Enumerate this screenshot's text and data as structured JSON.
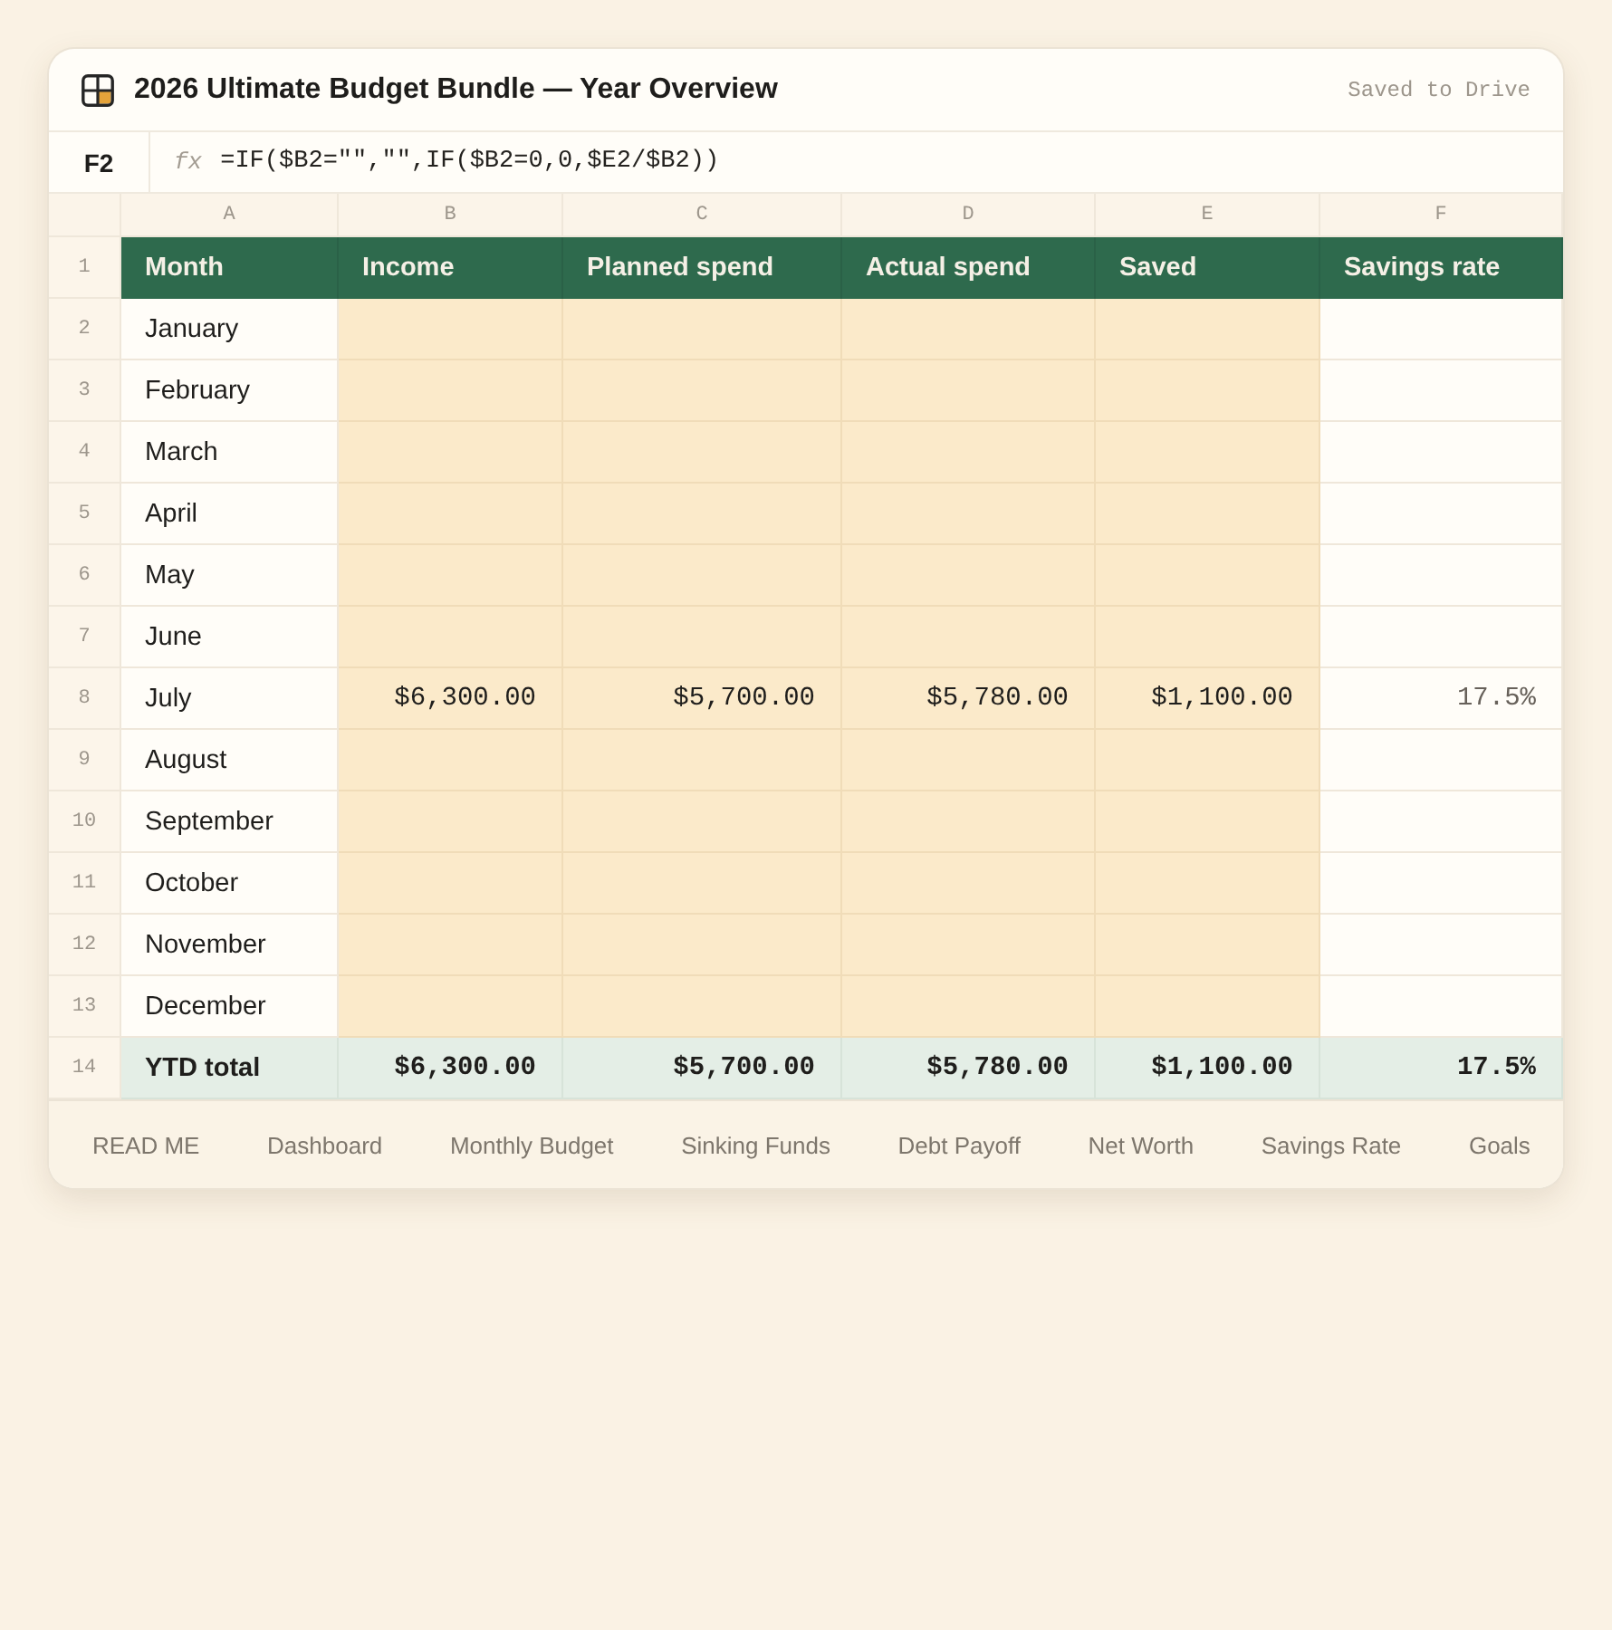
{
  "window": {
    "title": "2026 Ultimate Budget Bundle — Year Overview",
    "status": "Saved to Drive"
  },
  "formula_bar": {
    "cell_ref": "F2",
    "fx": "fx",
    "formula": "=IF($B2=\"\",\"\",IF($B2=0,0,$E2/$B2))"
  },
  "sheet": {
    "columns": [
      {
        "letter": "A",
        "heading": "Month",
        "input": false
      },
      {
        "letter": "B",
        "heading": "Income",
        "input": true
      },
      {
        "letter": "C",
        "heading": "Planned spend",
        "input": true
      },
      {
        "letter": "D",
        "heading": "Actual spend",
        "input": true
      },
      {
        "letter": "E",
        "heading": "Saved",
        "input": true
      },
      {
        "letter": "F",
        "heading": "Savings rate",
        "input": false
      }
    ],
    "header_row": "1",
    "rows": [
      {
        "number": "2",
        "kind": "month",
        "cells": [
          "January"
        ]
      },
      {
        "number": "3",
        "kind": "month",
        "cells": [
          "February"
        ]
      },
      {
        "number": "4",
        "kind": "month",
        "cells": [
          "March"
        ]
      },
      {
        "number": "5",
        "kind": "month",
        "cells": [
          "April"
        ]
      },
      {
        "number": "6",
        "kind": "month",
        "cells": [
          "May"
        ]
      },
      {
        "number": "7",
        "kind": "month",
        "cells": [
          "June"
        ]
      },
      {
        "number": "8",
        "kind": "month",
        "cells": [
          "July",
          "$6,300.00",
          "$5,700.00",
          "$5,780.00",
          "$1,100.00",
          "17.5%"
        ]
      },
      {
        "number": "9",
        "kind": "month",
        "cells": [
          "August"
        ]
      },
      {
        "number": "10",
        "kind": "month",
        "cells": [
          "September"
        ]
      },
      {
        "number": "11",
        "kind": "month",
        "cells": [
          "October"
        ]
      },
      {
        "number": "12",
        "kind": "month",
        "cells": [
          "November"
        ]
      },
      {
        "number": "13",
        "kind": "month",
        "cells": [
          "December"
        ]
      },
      {
        "number": "14",
        "kind": "total",
        "cells": [
          "YTD total",
          "$6,300.00",
          "$5,700.00",
          "$5,780.00",
          "$1,100.00",
          "17.5%"
        ]
      }
    ]
  },
  "sheet_tabs": [
    {
      "label": "READ ME",
      "selected": false
    },
    {
      "label": "Dashboard",
      "selected": false
    },
    {
      "label": "Monthly Budget",
      "selected": false
    },
    {
      "label": "Sinking Funds",
      "selected": false
    },
    {
      "label": "Debt Payoff",
      "selected": false
    },
    {
      "label": "Net Worth",
      "selected": false
    },
    {
      "label": "Savings Rate",
      "selected": false
    },
    {
      "label": "Goals",
      "selected": false
    }
  ]
}
